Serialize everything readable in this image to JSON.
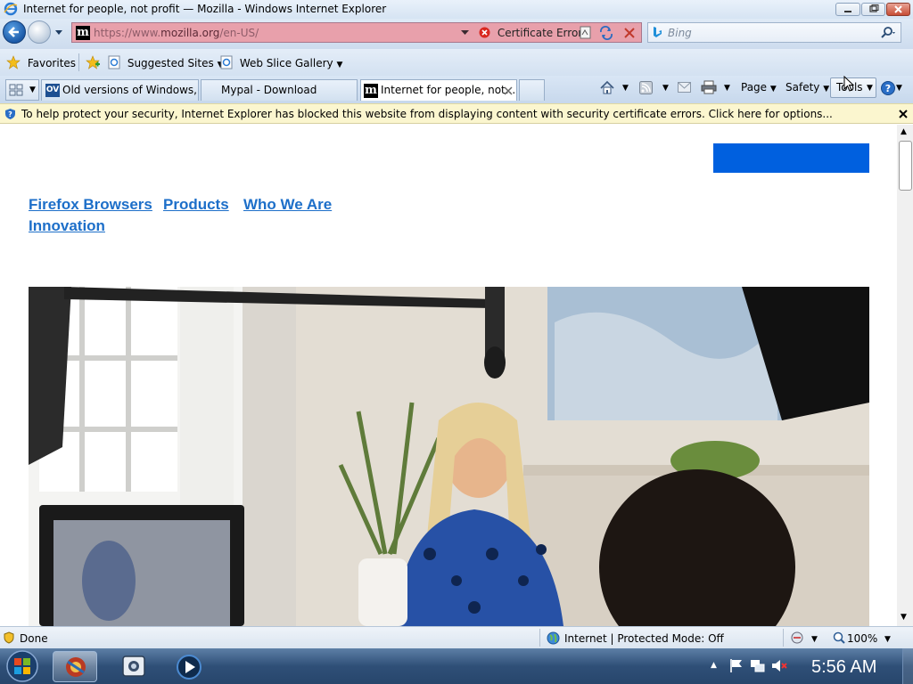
{
  "window": {
    "title": "Internet for people, not profit — Mozilla - Windows Internet Explorer"
  },
  "address_bar": {
    "url_prefix": "https://www.",
    "url_domain": "mozilla.org",
    "url_suffix": "/en-US/",
    "cert_error_label": "Certificate Error",
    "search_placeholder": "Bing"
  },
  "favorites_bar": {
    "favorites_label": "Favorites",
    "items": [
      {
        "label": "Suggested Sites"
      },
      {
        "label": "Web Slice Gallery"
      }
    ]
  },
  "tabs": [
    {
      "icon_text": "OV",
      "label": "Old versions of Windows, ..."
    },
    {
      "label": "Mypal - Download"
    },
    {
      "icon_text": "m",
      "label": "Internet for people, not..."
    }
  ],
  "command_bar": {
    "page_label": "Page",
    "safety_label": "Safety",
    "tools_label": "Tools"
  },
  "infobar": {
    "message": "To help protect your security, Internet Explorer has blocked this website from displaying content with security certificate errors. Click here for options..."
  },
  "page": {
    "nav_links": [
      "Firefox Browsers",
      "Products",
      "Who We Are",
      "Innovation"
    ],
    "accent_color": "#0060df"
  },
  "status_bar": {
    "status": "Done",
    "zone": "Internet | Protected Mode: Off",
    "zoom": "100%"
  },
  "taskbar": {
    "clock": "5:56 AM"
  }
}
